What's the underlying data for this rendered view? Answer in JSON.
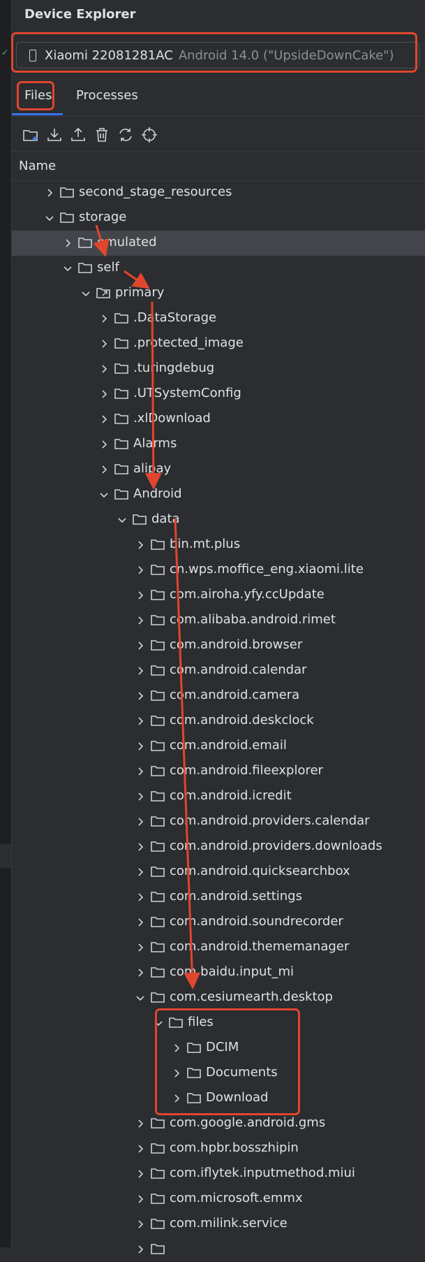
{
  "title": "Device Explorer",
  "device": {
    "model": "Xiaomi 22081281AC",
    "os": "Android 14.0 (\"UpsideDownCake\")"
  },
  "tabs": [
    {
      "label": "Files",
      "active": true
    },
    {
      "label": "Processes",
      "active": false
    }
  ],
  "toolbar": [
    "new-folder-icon",
    "download-icon",
    "upload-icon",
    "delete-icon",
    "sync-icon",
    "locate-icon"
  ],
  "column_header": "Name",
  "tree": [
    {
      "label": "second_stage_resources",
      "depth": 0,
      "expanded": false
    },
    {
      "label": "storage",
      "depth": 0,
      "expanded": true
    },
    {
      "label": "emulated",
      "depth": 1,
      "expanded": false,
      "selected": true
    },
    {
      "label": "self",
      "depth": 1,
      "expanded": true
    },
    {
      "label": "primary",
      "depth": 2,
      "expanded": true,
      "link": true
    },
    {
      "label": ".DataStorage",
      "depth": 3,
      "expanded": false
    },
    {
      "label": ".protected_image",
      "depth": 3,
      "expanded": false
    },
    {
      "label": ".turingdebug",
      "depth": 3,
      "expanded": false
    },
    {
      "label": ".UTSystemConfig",
      "depth": 3,
      "expanded": false
    },
    {
      "label": ".xlDownload",
      "depth": 3,
      "expanded": false
    },
    {
      "label": "Alarms",
      "depth": 3,
      "expanded": false
    },
    {
      "label": "alipay",
      "depth": 3,
      "expanded": false
    },
    {
      "label": "Android",
      "depth": 3,
      "expanded": true
    },
    {
      "label": "data",
      "depth": 4,
      "expanded": true
    },
    {
      "label": "bin.mt.plus",
      "depth": 5,
      "expanded": false
    },
    {
      "label": "cn.wps.moffice_eng.xiaomi.lite",
      "depth": 5,
      "expanded": false
    },
    {
      "label": "com.airoha.yfy.ccUpdate",
      "depth": 5,
      "expanded": false
    },
    {
      "label": "com.alibaba.android.rimet",
      "depth": 5,
      "expanded": false
    },
    {
      "label": "com.android.browser",
      "depth": 5,
      "expanded": false
    },
    {
      "label": "com.android.calendar",
      "depth": 5,
      "expanded": false
    },
    {
      "label": "com.android.camera",
      "depth": 5,
      "expanded": false
    },
    {
      "label": "com.android.deskclock",
      "depth": 5,
      "expanded": false
    },
    {
      "label": "com.android.email",
      "depth": 5,
      "expanded": false
    },
    {
      "label": "com.android.fileexplorer",
      "depth": 5,
      "expanded": false
    },
    {
      "label": "com.android.icredit",
      "depth": 5,
      "expanded": false
    },
    {
      "label": "com.android.providers.calendar",
      "depth": 5,
      "expanded": false
    },
    {
      "label": "com.android.providers.downloads",
      "depth": 5,
      "expanded": false
    },
    {
      "label": "com.android.quicksearchbox",
      "depth": 5,
      "expanded": false
    },
    {
      "label": "com.android.settings",
      "depth": 5,
      "expanded": false
    },
    {
      "label": "com.android.soundrecorder",
      "depth": 5,
      "expanded": false
    },
    {
      "label": "com.android.thememanager",
      "depth": 5,
      "expanded": false
    },
    {
      "label": "com.baidu.input_mi",
      "depth": 5,
      "expanded": false
    },
    {
      "label": "com.cesiumearth.desktop",
      "depth": 5,
      "expanded": true
    },
    {
      "label": "files",
      "depth": 6,
      "expanded": true
    },
    {
      "label": "DCIM",
      "depth": 7,
      "expanded": false
    },
    {
      "label": "Documents",
      "depth": 7,
      "expanded": false
    },
    {
      "label": "Download",
      "depth": 7,
      "expanded": false
    },
    {
      "label": "com.google.android.gms",
      "depth": 5,
      "expanded": false
    },
    {
      "label": "com.hpbr.bosszhipin",
      "depth": 5,
      "expanded": false
    },
    {
      "label": "com.iflytek.inputmethod.miui",
      "depth": 5,
      "expanded": false
    },
    {
      "label": "com.microsoft.emmx",
      "depth": 5,
      "expanded": false
    },
    {
      "label": "com.milink.service",
      "depth": 5,
      "expanded": false
    },
    {
      "label": "",
      "depth": 5,
      "expanded": false
    }
  ],
  "colors": {
    "background": "#2b2d30",
    "text": "#dfe1e5",
    "accent": "#3574f0",
    "annotation": "#e0462e"
  }
}
